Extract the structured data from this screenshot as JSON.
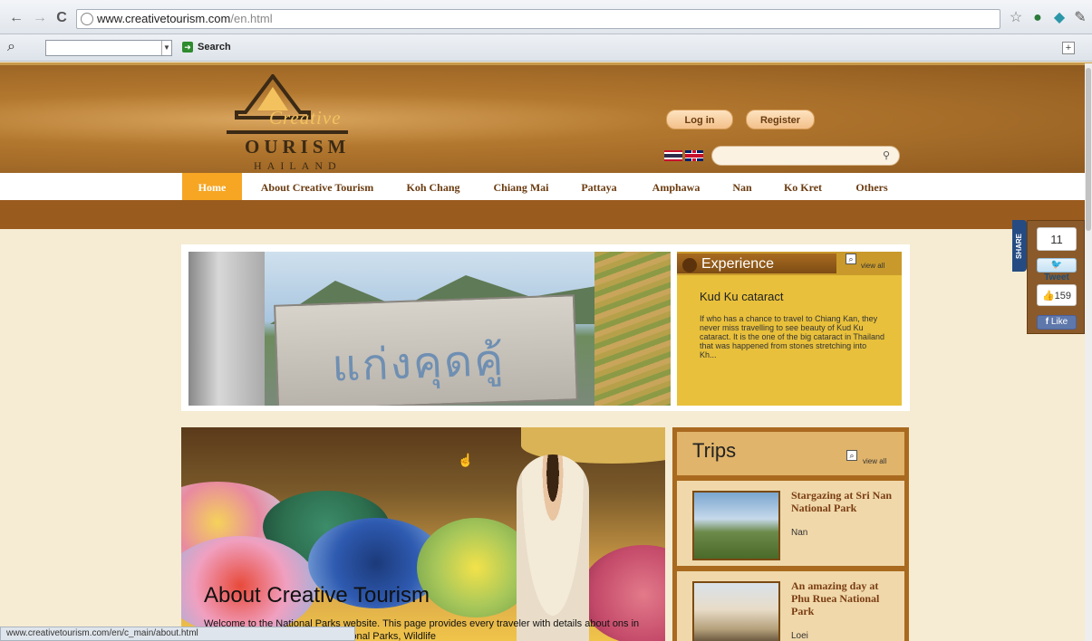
{
  "browser": {
    "url_domain": "www.creativetourism.com",
    "url_path": "/en.html",
    "status_url": "www.creativetourism.com/en/c_main/about.html"
  },
  "toolbar": {
    "search_label": "Search"
  },
  "site": {
    "logo_c": "Creative",
    "logo_o": "OURISM",
    "logo_h": "HAILAND",
    "login_label": "Log in",
    "register_label": "Register"
  },
  "nav": {
    "items": [
      "Home",
      "About Creative Tourism",
      "Koh Chang",
      "Chiang Mai",
      "Pattaya",
      "Amphawa",
      "Nan",
      "Ko Kret",
      "Others"
    ]
  },
  "share": {
    "tab_label": "SHARE",
    "tweet_count": "11",
    "tweet_label": "Tweet",
    "like_count": "159",
    "like_label": "Like"
  },
  "experience": {
    "title": "Experience",
    "view_all": "view all",
    "item_title": "Kud Ku cataract",
    "item_desc": "If who has a chance to travel to Chiang Kan, they never miss travelling to see beauty of Kud Ku cataract. It is the one of the big cataract in Thailand that was happened from stones stretching into Kh..."
  },
  "hero": {
    "sign_text": "แก่งคุดคู้"
  },
  "feature": {
    "title": "About Creative Tourism",
    "desc": "Welcome to the National Parks website. This page provides every traveler with details about ons in Thailand. The Department of National Parks, Wildlife"
  },
  "trips": {
    "title": "Trips",
    "view_all": "view all",
    "items": [
      {
        "title": "Stargazing at Sri Nan National Park",
        "location": "Nan"
      },
      {
        "title": "An amazing day at Phu Ruea National Park",
        "location": "Loei"
      }
    ]
  }
}
